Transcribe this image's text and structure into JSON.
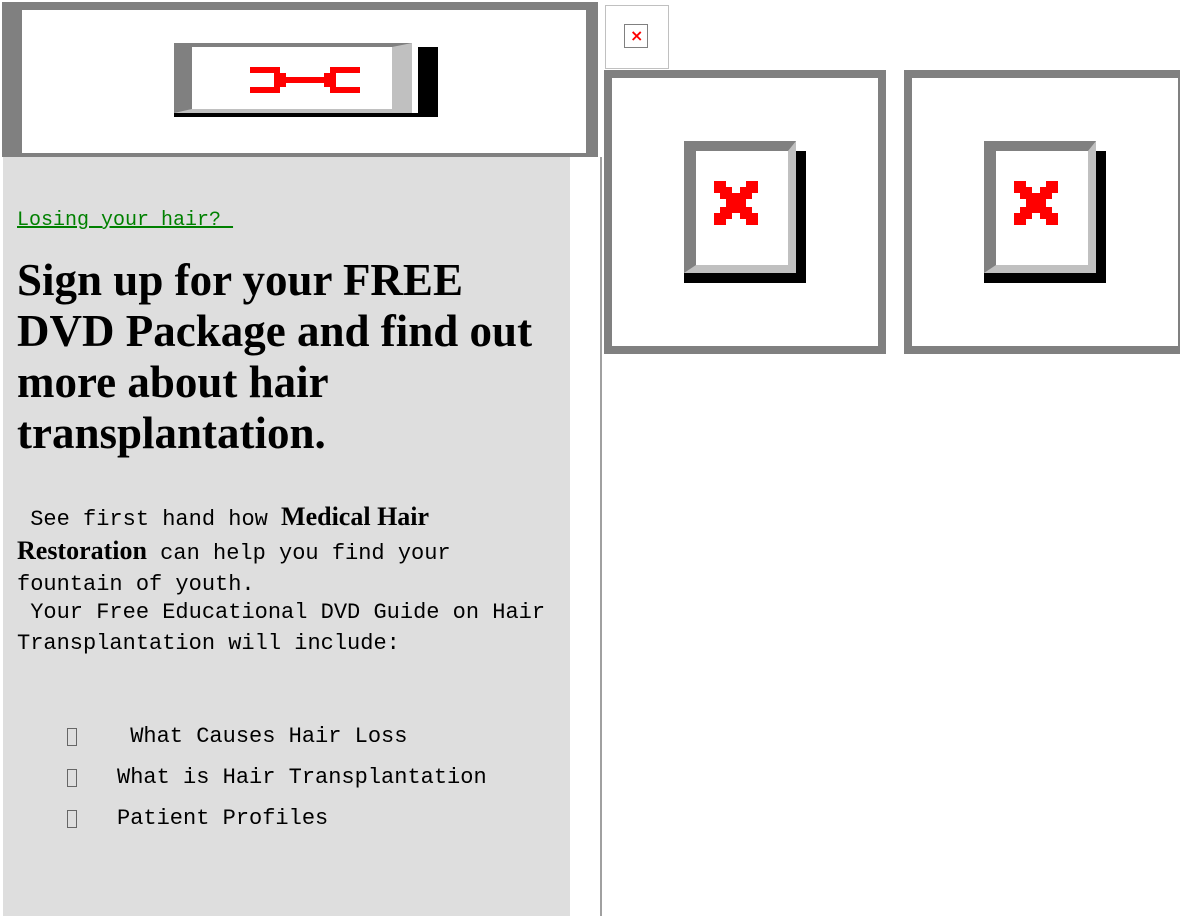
{
  "promo": {
    "link_text": "Losing your hair? ",
    "headline": "Sign up for your FREE DVD Package and find out more about hair transplantation.",
    "para1_prefix": " See first hand how ",
    "para1_bold": "Medical Hair Restoration",
    "para1_suffix": " can help you find your fountain of youth.",
    "para2": " Your Free Educational DVD Guide on Hair Transplantation will include:",
    "bullets": [
      " What Causes Hair Loss",
      "What is Hair Transplantation",
      "Patient Profiles"
    ]
  },
  "icons": {
    "broken_image": "broken-image-icon",
    "bullet": "missing-glyph-box"
  },
  "colors": {
    "frame_gray": "#808080",
    "panel_bg": "#dedede",
    "link_green": "#008000",
    "broken_red": "#ff0000"
  }
}
